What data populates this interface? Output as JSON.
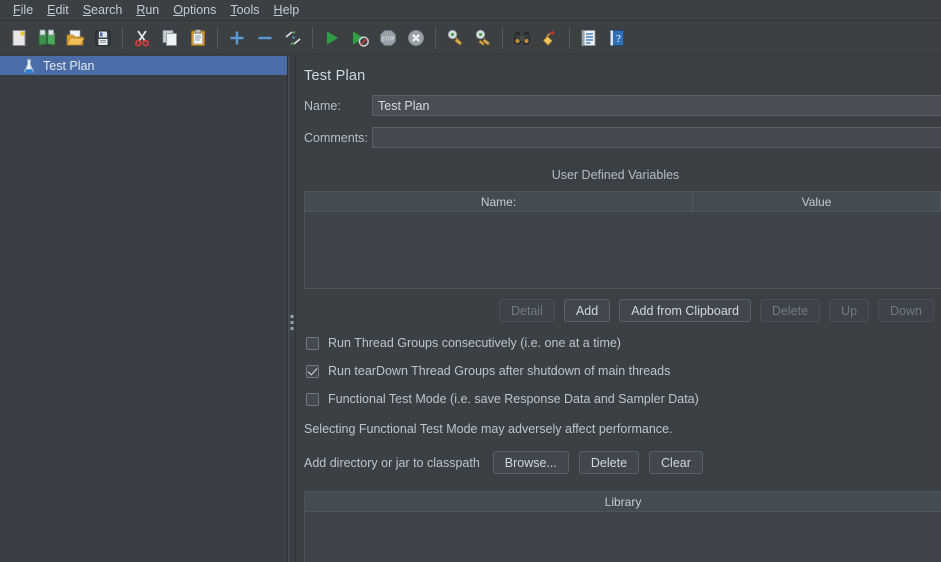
{
  "menubar": {
    "items": [
      {
        "label": "File",
        "mnemonic": "F"
      },
      {
        "label": "Edit",
        "mnemonic": "E"
      },
      {
        "label": "Search",
        "mnemonic": "S"
      },
      {
        "label": "Run",
        "mnemonic": "R"
      },
      {
        "label": "Options",
        "mnemonic": "O"
      },
      {
        "label": "Tools",
        "mnemonic": "T"
      },
      {
        "label": "Help",
        "mnemonic": "H"
      }
    ]
  },
  "toolbar": {
    "items": [
      {
        "icon": "new-document-icon",
        "name": "new-test-plan-button"
      },
      {
        "icon": "templates-book-icon",
        "name": "templates-button"
      },
      {
        "icon": "open-folder-icon",
        "name": "open-button"
      },
      {
        "icon": "save-floppy-icon",
        "name": "save-button"
      },
      {
        "icon": "separator",
        "name": "toolbar-separator-1"
      },
      {
        "icon": "scissors-icon",
        "name": "cut-button"
      },
      {
        "icon": "copy-icon",
        "name": "copy-button"
      },
      {
        "icon": "paste-clipboard-icon",
        "name": "paste-button"
      },
      {
        "icon": "separator",
        "name": "toolbar-separator-2"
      },
      {
        "icon": "plus-icon",
        "name": "expand-all-button"
      },
      {
        "icon": "minus-icon",
        "name": "collapse-all-button"
      },
      {
        "icon": "toggle-icon",
        "name": "toggle-button"
      },
      {
        "icon": "separator",
        "name": "toolbar-separator-3"
      },
      {
        "icon": "play-icon",
        "name": "start-button"
      },
      {
        "icon": "play-no-timers-icon",
        "name": "start-no-pauses-button"
      },
      {
        "icon": "stop-icon",
        "name": "stop-button"
      },
      {
        "icon": "shutdown-icon",
        "name": "shutdown-button"
      },
      {
        "icon": "separator",
        "name": "toolbar-separator-4"
      },
      {
        "icon": "clear-broom-icon",
        "name": "clear-button"
      },
      {
        "icon": "clear-all-broom-icon",
        "name": "clear-all-button"
      },
      {
        "icon": "separator",
        "name": "toolbar-separator-5"
      },
      {
        "icon": "binoculars-icon",
        "name": "search-button"
      },
      {
        "icon": "broom-icon",
        "name": "reset-search-button"
      },
      {
        "icon": "separator",
        "name": "toolbar-separator-6"
      },
      {
        "icon": "function-helper-icon",
        "name": "function-helper-button"
      },
      {
        "icon": "help-icon",
        "name": "help-button"
      }
    ]
  },
  "tree": {
    "items": [
      {
        "label": "Test Plan",
        "icon": "test-plan-flask-icon",
        "selected": true
      }
    ]
  },
  "editor": {
    "title": "Test Plan",
    "name_label": "Name:",
    "name_value": "Test Plan",
    "comments_label": "Comments:",
    "comments_value": "",
    "comments_placeholder": "",
    "udv_section_title": "User Defined Variables",
    "udv_columns": [
      "Name:",
      "Value"
    ],
    "udv_rows": [],
    "udv_buttons": [
      {
        "label": "Detail",
        "enabled": false,
        "name": "detail-button"
      },
      {
        "label": "Add",
        "enabled": true,
        "name": "add-button"
      },
      {
        "label": "Add from Clipboard",
        "enabled": true,
        "name": "add-from-clipboard-button"
      },
      {
        "label": "Delete",
        "enabled": false,
        "name": "delete-variable-button"
      },
      {
        "label": "Up",
        "enabled": false,
        "name": "move-up-button"
      },
      {
        "label": "Down",
        "enabled": false,
        "name": "move-down-button"
      }
    ],
    "checkboxes": [
      {
        "label": "Run Thread Groups consecutively (i.e. one at a time)",
        "checked": false,
        "name": "run-thread-groups-consecutively-checkbox"
      },
      {
        "label": "Run tearDown Thread Groups after shutdown of main threads",
        "checked": true,
        "name": "run-teardown-thread-groups-checkbox"
      },
      {
        "label": "Functional Test Mode (i.e. save Response Data and Sampler Data)",
        "checked": false,
        "name": "functional-test-mode-checkbox"
      }
    ],
    "functional_note": "Selecting Functional Test Mode may adversely affect performance.",
    "classpath_label": "Add directory or jar to classpath",
    "classpath_buttons": [
      {
        "label": "Browse...",
        "enabled": true,
        "name": "browse-button"
      },
      {
        "label": "Delete",
        "enabled": true,
        "name": "delete-classpath-button"
      },
      {
        "label": "Clear",
        "enabled": true,
        "name": "clear-classpath-button"
      }
    ],
    "library_column": "Library",
    "library_rows": []
  },
  "colors": {
    "background": "#3c4043",
    "selection_blue": "#4a6da7",
    "text": "#bfc4c9",
    "field_background": "#4a4e52",
    "accent_blue": "#5b9bd5"
  }
}
